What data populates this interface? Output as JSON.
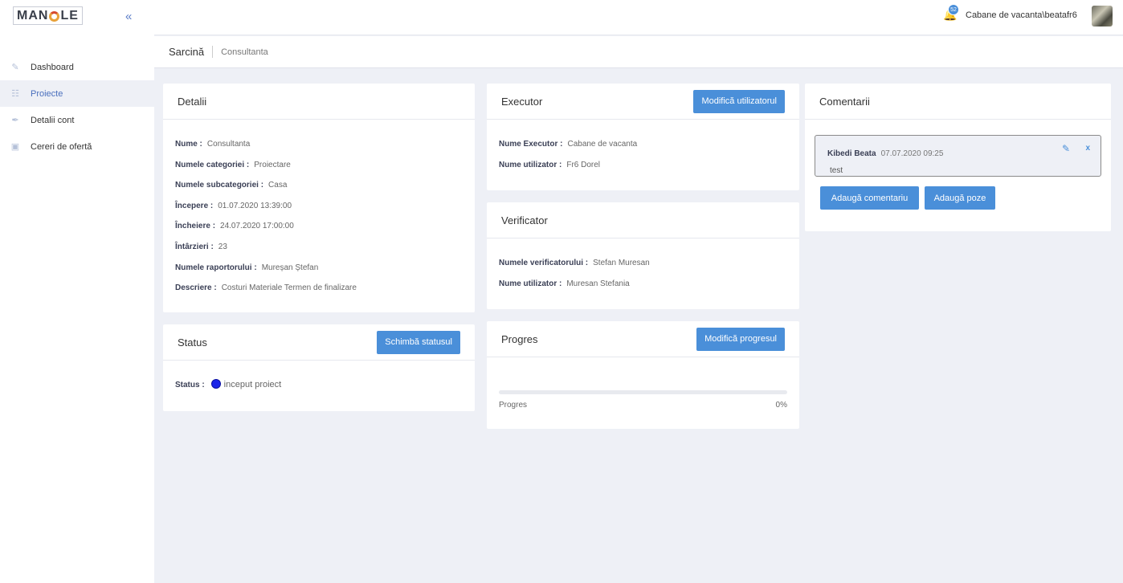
{
  "logo": {
    "text_before": "MAN",
    "text_after": "LE"
  },
  "sidebar": {
    "items": [
      {
        "label": "Dashboard",
        "icon": "dashboard-icon"
      },
      {
        "label": "Proiecte",
        "icon": "clipboard-icon"
      },
      {
        "label": "Detalii cont",
        "icon": "pen-icon"
      },
      {
        "label": "Cereri de ofertă",
        "icon": "briefcase-icon"
      }
    ],
    "active_index": 1
  },
  "topbar": {
    "notification_count": "52",
    "user_name": "Cabane de vacanta\\beatafr6"
  },
  "breadcrumb": {
    "main": "Sarcină",
    "sub": "Consultanta"
  },
  "detalii": {
    "title": "Detalii",
    "rows": [
      {
        "key": "Nume :",
        "value": "Consultanta"
      },
      {
        "key": "Numele categoriei :",
        "value": "Proiectare"
      },
      {
        "key": "Numele subcategoriei :",
        "value": "Casa"
      },
      {
        "key": "Începere :",
        "value": "01.07.2020 13:39:00"
      },
      {
        "key": "Încheiere :",
        "value": "24.07.2020 17:00:00"
      },
      {
        "key": "Întârzieri :",
        "value": "23"
      },
      {
        "key": "Numele raportorului :",
        "value": "Mureșan Ștefan"
      },
      {
        "key": "Descriere :",
        "value": "Costuri Materiale Termen de finalizare"
      }
    ]
  },
  "status": {
    "title": "Status",
    "button": "Schimbă statusul",
    "key": "Status :",
    "value": "inceput proiect",
    "dot_color": "#1a24e8"
  },
  "executor": {
    "title": "Executor",
    "button": "Modifică utilizatorul",
    "rows": [
      {
        "key": "Nume Executor :",
        "value": "Cabane de vacanta"
      },
      {
        "key": "Nume utilizator :",
        "value": "Fr6 Dorel"
      }
    ]
  },
  "verificator": {
    "title": "Verificator",
    "rows": [
      {
        "key": "Numele verificatorului :",
        "value": "Stefan Muresan"
      },
      {
        "key": "Nume utilizator :",
        "value": "Muresan Stefania"
      }
    ]
  },
  "progres": {
    "title": "Progres",
    "button": "Modifică progresul",
    "label": "Progres",
    "value_text": "0%",
    "value": 0
  },
  "comentarii": {
    "title": "Comentarii",
    "comment": {
      "author": "Kibedi Beata",
      "date": "07.07.2020 09:25",
      "text": "test"
    },
    "add_comment": "Adaugă comentariu",
    "add_photos": "Adaugă poze"
  },
  "colors": {
    "accent": "#4a8fd9",
    "background": "#eef0f6"
  }
}
